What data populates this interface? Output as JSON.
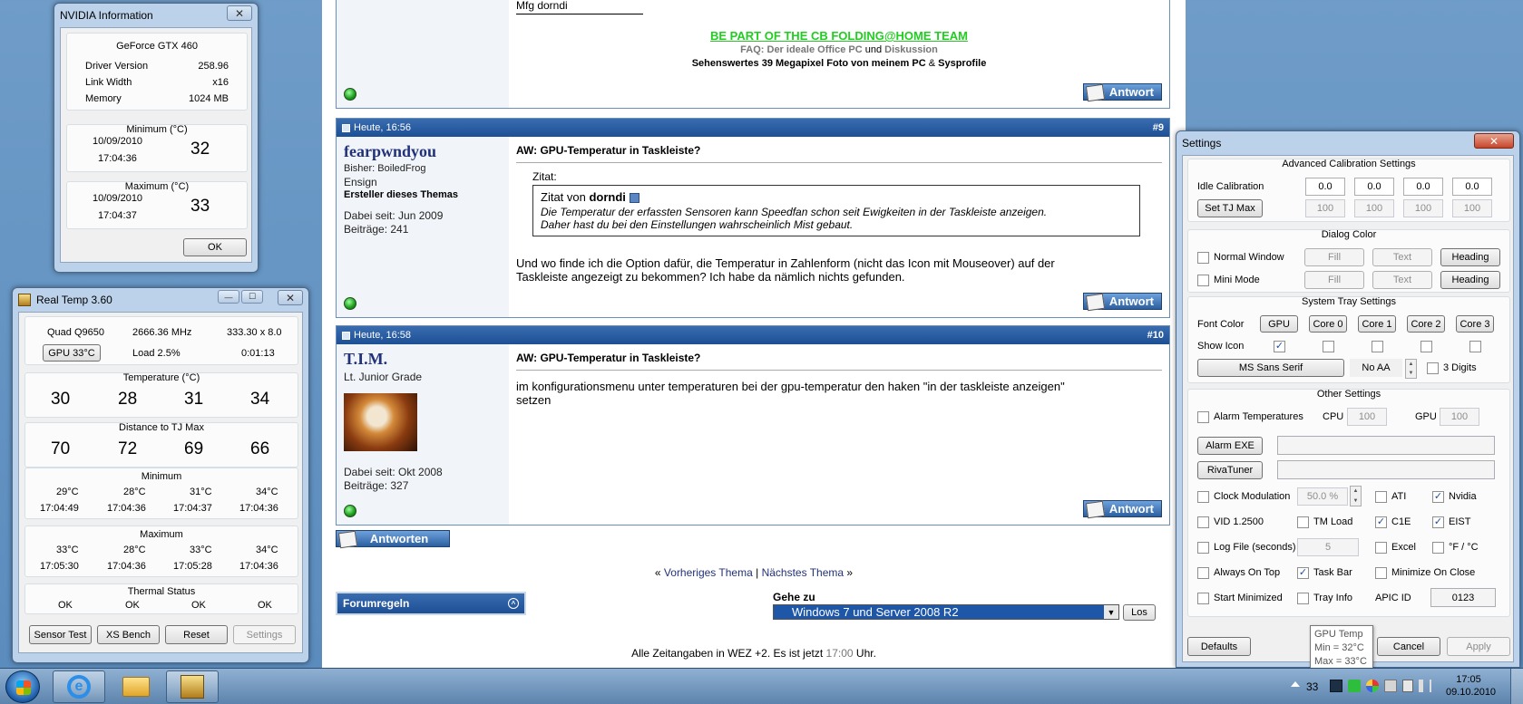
{
  "forum": {
    "sig_team": "BE PART OF THE CB FOLDING@HOME TEAM",
    "sig_faq_prefix": "FAQ:",
    "sig_faq_link": "Der ideale Office PC",
    "sig_faq_and": "und",
    "sig_faq_link2": "Diskussion",
    "sig_line2_bold": "Sehenswertes 39 Megapixel Foto von meinem PC",
    "sig_line2_amp": "&",
    "sig_line2_link": "Sysprofile",
    "sig_top_fragment": "Mfg dorndi",
    "reply_label": "Antwort",
    "posts": [
      {
        "time": "Heute, 16:56",
        "number": "#9",
        "username": "fearpwndyou",
        "subtitle": "Bisher: BoiledFrog",
        "rank": "Ensign",
        "badge": "Ersteller dieses Themas",
        "joined": "Dabei seit: Jun 2009",
        "posts_count": "Beiträge: 241",
        "title": "AW: GPU-Temperatur in Taskleiste?",
        "quote_label": "Zitat:",
        "quote_from_prefix": "Zitat von",
        "quote_author": "dorndi",
        "quote_line1": "Die Temperatur der erfassten Sensoren kann Speedfan schon seit Ewigkeiten in der Taskleiste anzeigen.",
        "quote_line2": "Daher hast du bei den Einstellungen wahrscheinlich Mist gebaut.",
        "body_line1": "Und wo finde ich die Option dafür, die Temperatur in Zahlenform (nicht das Icon mit Mouseover) auf der",
        "body_line2": "Taskleiste angezeigt zu bekommen? Ich habe da nämlich nichts gefunden."
      },
      {
        "time": "Heute, 16:58",
        "number": "#10",
        "username": "T.I.M.",
        "rank": "Lt. Junior Grade",
        "joined": "Dabei seit: Okt 2008",
        "posts_count": "Beiträge: 327",
        "title": "AW: GPU-Temperatur in Taskleiste?",
        "body_line1": "im konfigurationsmenu unter temperaturen bei der gpu-temperatur den haken \"in der taskleiste anzeigen\"",
        "body_line2": "setzen"
      }
    ],
    "reply_all_label": "Antworten",
    "prev_thread": "Vorheriges Thema",
    "next_thread": "Nächstes Thema",
    "nav_open": "«",
    "nav_sep": "|",
    "nav_close": "»",
    "forum_rules": "Forumregeln",
    "goto_label": "Gehe zu",
    "goto_selected": "Windows 7 und Server 2008 R2",
    "goto_button": "Los",
    "tz_prefix": "Alle Zeitangaben in WEZ +2. Es ist jetzt",
    "tz_time": "17:00",
    "tz_suffix": "Uhr."
  },
  "nvidia": {
    "title": "NVIDIA Information",
    "gpu": "GeForce GTX 460",
    "driver_label": "Driver Version",
    "driver_value": "258.96",
    "link_label": "Link Width",
    "link_value": "x16",
    "memory_label": "Memory",
    "memory_value": "1024 MB",
    "min_title": "Minimum (°C)",
    "min_date": "10/09/2010",
    "min_time": "17:04:36",
    "min_value": "32",
    "max_title": "Maximum (°C)",
    "max_date": "10/09/2010",
    "max_time": "17:04:37",
    "max_value": "33",
    "ok": "OK"
  },
  "realtemp": {
    "title": "Real Temp 3.60",
    "cpu": "Quad Q9650",
    "freq": "2666.36 MHz",
    "mult": "333.30 x 8.0",
    "gpu_button": "GPU  33°C",
    "load": "Load   2.5%",
    "uptime": "0:01:13",
    "temp_title": "Temperature (°C)",
    "temps": [
      "30",
      "28",
      "31",
      "34"
    ],
    "dist_title": "Distance to TJ Max",
    "dists": [
      "70",
      "72",
      "69",
      "66"
    ],
    "min_title": "Minimum",
    "min_vals": [
      "29°C",
      "28°C",
      "31°C",
      "34°C"
    ],
    "min_times": [
      "17:04:49",
      "17:04:36",
      "17:04:37",
      "17:04:36"
    ],
    "max_title": "Maximum",
    "max_vals": [
      "33°C",
      "28°C",
      "33°C",
      "34°C"
    ],
    "max_times": [
      "17:05:30",
      "17:04:36",
      "17:05:28",
      "17:04:36"
    ],
    "thermal_title": "Thermal Status",
    "thermal": [
      "OK",
      "OK",
      "OK",
      "OK"
    ],
    "buttons": [
      "Sensor Test",
      "XS Bench",
      "Reset",
      "Settings"
    ]
  },
  "settings": {
    "title": "Settings",
    "adv_title": "Advanced Calibration Settings",
    "idle_label": "Idle Calibration",
    "idle_values": [
      "0.0",
      "0.0",
      "0.0",
      "0.0"
    ],
    "tjmax_button": "Set TJ Max",
    "tjmax_values": [
      "100",
      "100",
      "100",
      "100"
    ],
    "dialog_title": "Dialog Color",
    "normal_window": "Normal Window",
    "mini_mode": "Mini Mode",
    "fill": "Fill",
    "text": "Text",
    "heading": "Heading",
    "tray_title": "System Tray Settings",
    "font_color": "Font Color",
    "tray_buttons": [
      "GPU",
      "Core 0",
      "Core 1",
      "Core 2",
      "Core 3"
    ],
    "show_icon": "Show Icon",
    "font_button": "MS Sans Serif",
    "no_aa": "No AA",
    "three_digits": "3 Digits",
    "other_title": "Other Settings",
    "alarm_temps": "Alarm Temperatures",
    "cpu_label": "CPU",
    "cpu_alarm": "100",
    "gpu_label": "GPU",
    "gpu_alarm": "100",
    "alarm_exe": "Alarm EXE",
    "rivatuner": "RivaTuner",
    "clock_mod": "Clock Modulation",
    "clock_value": "50.0 %",
    "ati": "ATI",
    "nvidia": "Nvidia",
    "vid": "VID   1.2500",
    "tm_load": "TM Load",
    "c1e": "C1E",
    "eist": "EIST",
    "log_file": "Log File (seconds)",
    "log_value": "5",
    "excel": "Excel",
    "fc": "°F / °C",
    "always_on_top": "Always On Top",
    "task_bar": "Task Bar",
    "min_on_close": "Minimize On Close",
    "start_min": "Start Minimized",
    "tray_info": "Tray Info",
    "apic_label": "APIC ID",
    "apic_value": "0123",
    "defaults": "Defaults",
    "cancel": "Cancel",
    "apply": "Apply"
  },
  "tooltip": {
    "line1": "GPU Temp",
    "line2": "Min = 32°C",
    "line3": "Max = 33°C"
  },
  "taskbar": {
    "tray_temp": "33",
    "clock_time": "17:05",
    "clock_date": "09.10.2010"
  },
  "colors": {
    "header_blue": "#1d4f95",
    "team_green": "#22cc22",
    "username_blue": "#22327a"
  }
}
